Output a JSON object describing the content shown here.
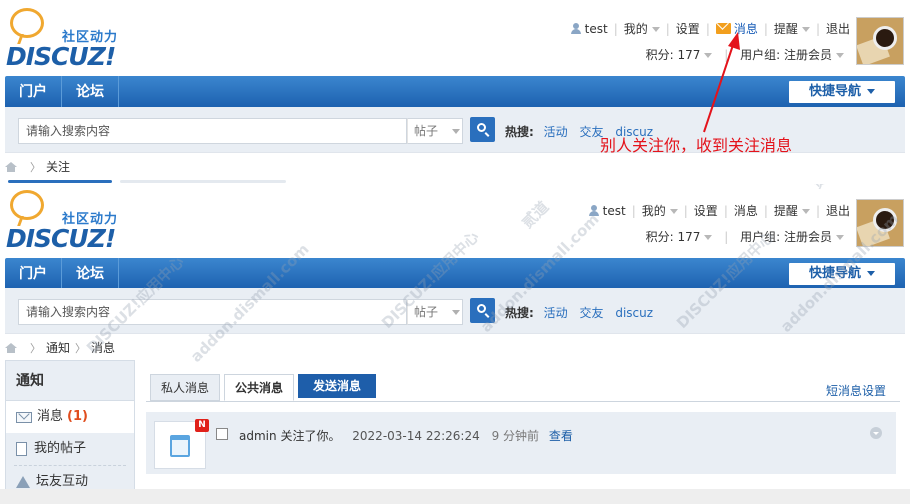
{
  "logo": {
    "tagline": "社区动力",
    "wordmark": "DISCUZ!"
  },
  "colors": {
    "nav_blue": "#1b5fae",
    "link_blue": "#1d5fa8",
    "annotation_red": "#e4131b",
    "mail_orange": "#f29f1e",
    "badge_red": "#e0211a"
  },
  "topbar": {
    "user": "test",
    "my": "我的",
    "settings": "设置",
    "messages": "消息",
    "reminders": "提醒",
    "logout": "退出",
    "points": "积分: 177",
    "usergroup": "用户组: 注册会员"
  },
  "nav": {
    "items": [
      "门户",
      "论坛"
    ],
    "quick_nav": "快捷导航"
  },
  "search": {
    "placeholder": "请输入搜索内容",
    "type": "帖子",
    "hot_label": "热搜:",
    "hot_terms": [
      "活动",
      "交友",
      "discuz"
    ]
  },
  "crumb1": [
    "关注"
  ],
  "crumb2": [
    "通知",
    "消息"
  ],
  "annotation": "别人关注你，收到关注消息",
  "sidebar": {
    "title": "通知",
    "items": [
      {
        "label": "消息",
        "count": "(1)",
        "icon": "mail-icon"
      },
      {
        "label": "我的帖子",
        "icon": "document-icon"
      },
      {
        "label": "坛友互动",
        "icon": "triangle-icon"
      }
    ]
  },
  "tabs": {
    "private": "私人消息",
    "public": "公共消息",
    "send": "发送消息"
  },
  "short_settings": "短消息设置",
  "message": {
    "badge": "N",
    "user": "admin",
    "text": "关注了你。",
    "datetime": "2022-03-14 22:26:24",
    "ago": "9 分钟前",
    "view": "查看"
  },
  "watermark": [
    "DISCUZ!应用中心",
    "addon.dismall.com",
    "贰道"
  ]
}
